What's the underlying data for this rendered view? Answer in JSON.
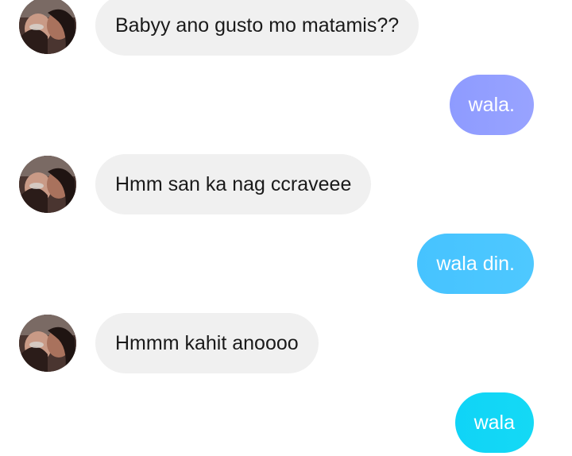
{
  "conversation": {
    "messages": [
      {
        "direction": "incoming",
        "text": "Babyy ano gusto mo matamis??"
      },
      {
        "direction": "outgoing",
        "text": "wala."
      },
      {
        "direction": "incoming",
        "text": "Hmm san ka nag ccraveee"
      },
      {
        "direction": "outgoing",
        "text": "wala din."
      },
      {
        "direction": "incoming",
        "text": "Hmmm kahit anoooo"
      },
      {
        "direction": "outgoing",
        "text": "wala"
      }
    ]
  },
  "colors": {
    "incoming_bubble": "#f0f0f0",
    "outgoing_bubble_1": "#939fff",
    "outgoing_bubble_2": "#4ac6ff",
    "outgoing_bubble_3": "#12d6f6",
    "incoming_text": "#1a1a1a",
    "outgoing_text": "#ffffff"
  }
}
